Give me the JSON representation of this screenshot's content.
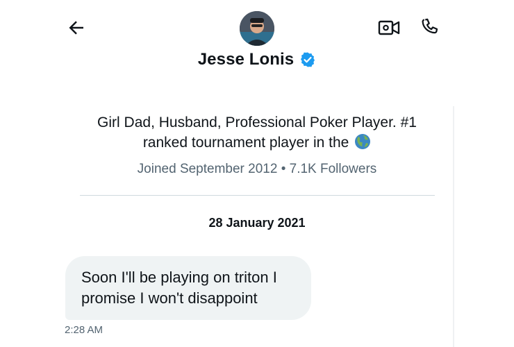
{
  "header": {
    "name": "Jesse Lonis",
    "verified": true,
    "icons": [
      "back-arrow-icon",
      "video-call-icon",
      "phone-icon"
    ]
  },
  "profile": {
    "bio_line1": "Girl Dad, Husband, Professional Poker Player. #1",
    "bio_line2": "ranked tournament player in the",
    "bio_emoji": "globe-emoji",
    "meta": "Joined September 2012 • 7.1K Followers"
  },
  "conversation": {
    "date": "28 January 2021",
    "messages": [
      {
        "line1": "Soon I'll be playing on triton I",
        "line2": "promise I won't disappoint",
        "time": "2:28 AM"
      }
    ]
  },
  "colors": {
    "verified_blue": "#1d9bf0",
    "bubble_bg": "#eff3f4",
    "secondary_text": "#536471"
  }
}
